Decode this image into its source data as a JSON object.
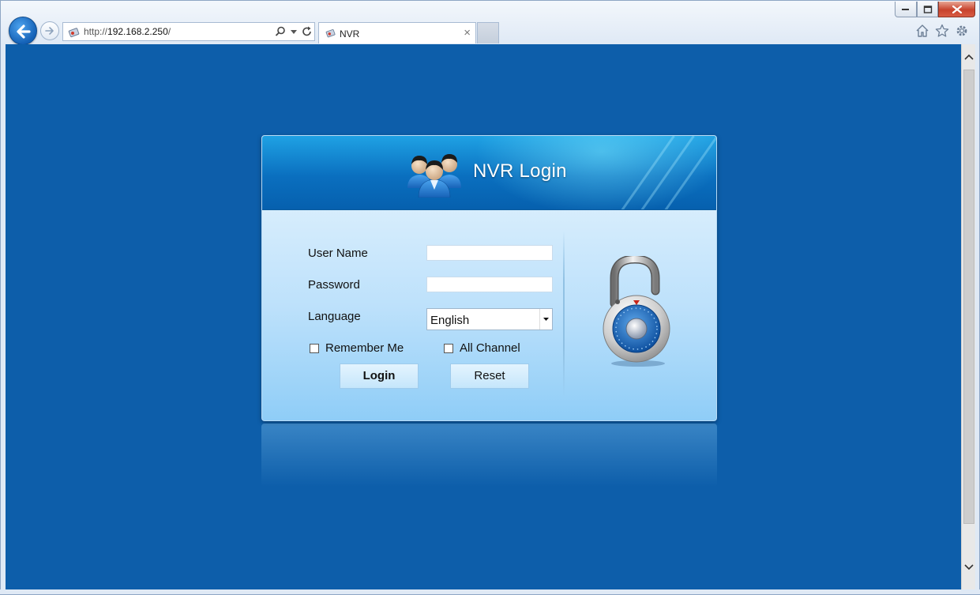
{
  "browser": {
    "address": {
      "scheme": "http://",
      "host": "192.168.2.250",
      "path": "/"
    },
    "tab_title": "NVR",
    "tab_close": "×"
  },
  "dialog": {
    "title": "NVR Login",
    "username_label": "User Name",
    "username_value": "",
    "password_label": "Password",
    "password_value": "",
    "language_label": "Language",
    "language_value": "English",
    "remember_label": "Remember Me",
    "remember_checked": false,
    "all_channel_label": "All Channel",
    "all_channel_checked": false,
    "login_button": "Login",
    "reset_button": "Reset"
  },
  "colors": {
    "page_background": "#0d5eaa",
    "header_blue": "#0a6fbf",
    "dialog_light_blue": "#bde1fb",
    "back_button_blue": "#1461b6",
    "close_button_red": "#c7432d"
  }
}
